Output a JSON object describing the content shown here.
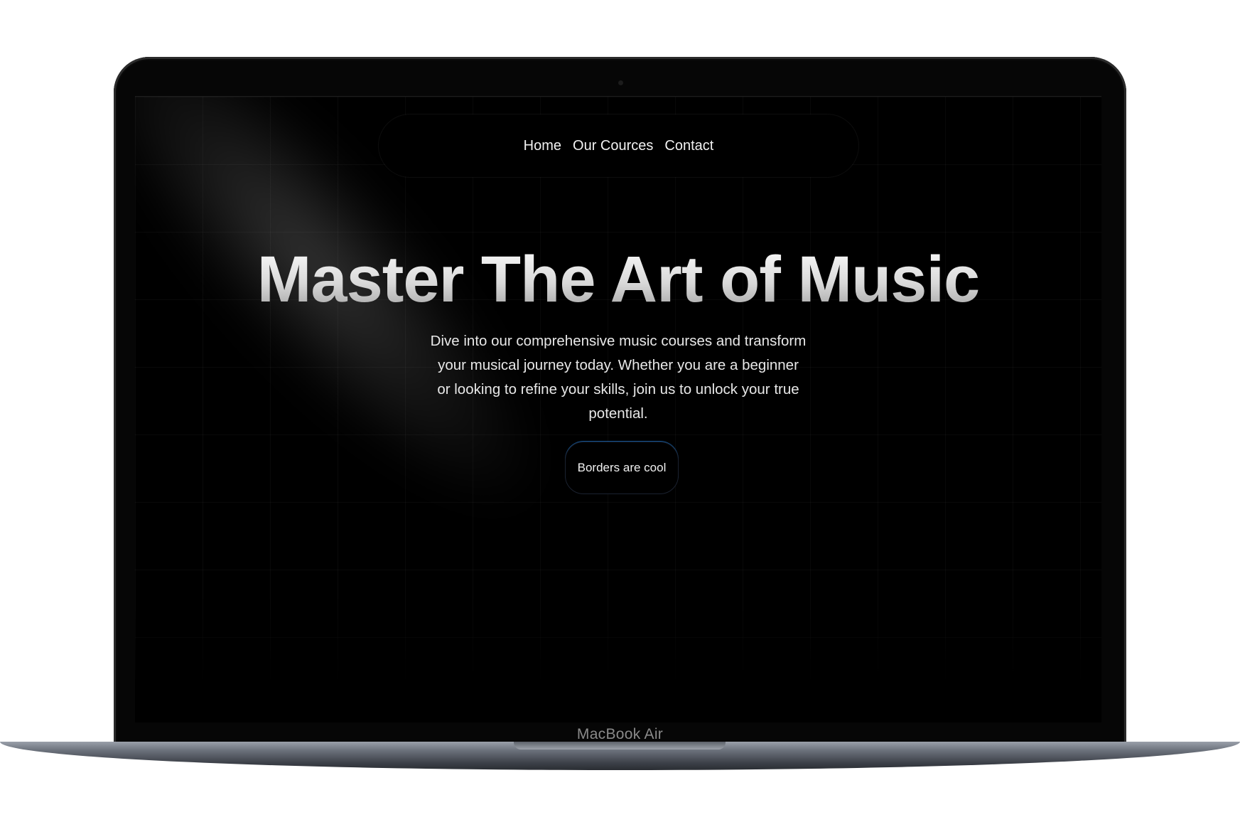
{
  "nav": {
    "links": [
      "Home",
      "Our Cources",
      "Contact"
    ]
  },
  "hero": {
    "title": "Master The Art of Music",
    "description": "Dive into our comprehensive music courses and transform your musical journey today. Whether you are a beginner or looking to refine your skills, join us to unlock your true potential.",
    "cta_label": "Borders are cool"
  },
  "device": {
    "label": "MacBook Air"
  },
  "colors": {
    "background": "#000000",
    "text": "#f2f2f2",
    "button_border_accent": "#1e90ff"
  }
}
